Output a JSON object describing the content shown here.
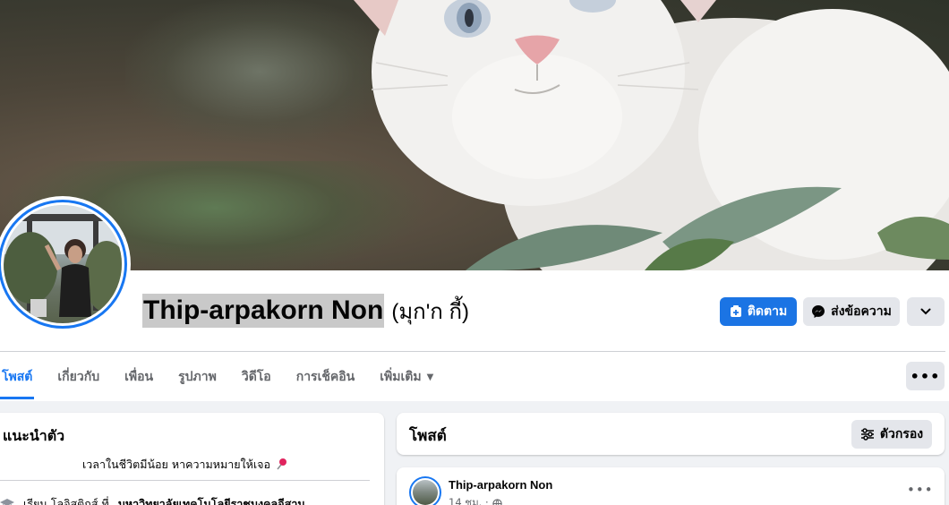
{
  "profile": {
    "name": "Thip-arpakorn Non",
    "alternate_name": "(มุก'ก กี้)"
  },
  "actions": {
    "follow_label": "ติดตาม",
    "message_label": "ส่งข้อความ",
    "more_icon": "chevron-down-icon"
  },
  "tabs": [
    {
      "label": "โพสต์",
      "active": true
    },
    {
      "label": "เกี่ยวกับ",
      "active": false
    },
    {
      "label": "เพื่อน",
      "active": false
    },
    {
      "label": "รูปภาพ",
      "active": false
    },
    {
      "label": "วิดีโอ",
      "active": false
    },
    {
      "label": "การเช็คอิน",
      "active": false
    },
    {
      "label": "เพิ่มเติม",
      "active": false
    }
  ],
  "intro": {
    "title": "แนะนำตัว",
    "bio": "เวลาในชีวิตมีน้อย หาความหมายให้เจอ",
    "education_prefix": "เรียน โลจิสติกส์ ที่",
    "education_school": "มหาวิทยาลัยเทคโนโลยีราชมงคลอีสาน"
  },
  "posts_section": {
    "title": "โพสต์",
    "filter_label": "ตัวกรอง"
  },
  "post": {
    "author": "Thip-arpakorn Non",
    "time": "14 ชม. ·"
  },
  "colors": {
    "accent": "#1877f2",
    "button_grey": "#e4e6eb",
    "background": "#f0f2f5"
  }
}
